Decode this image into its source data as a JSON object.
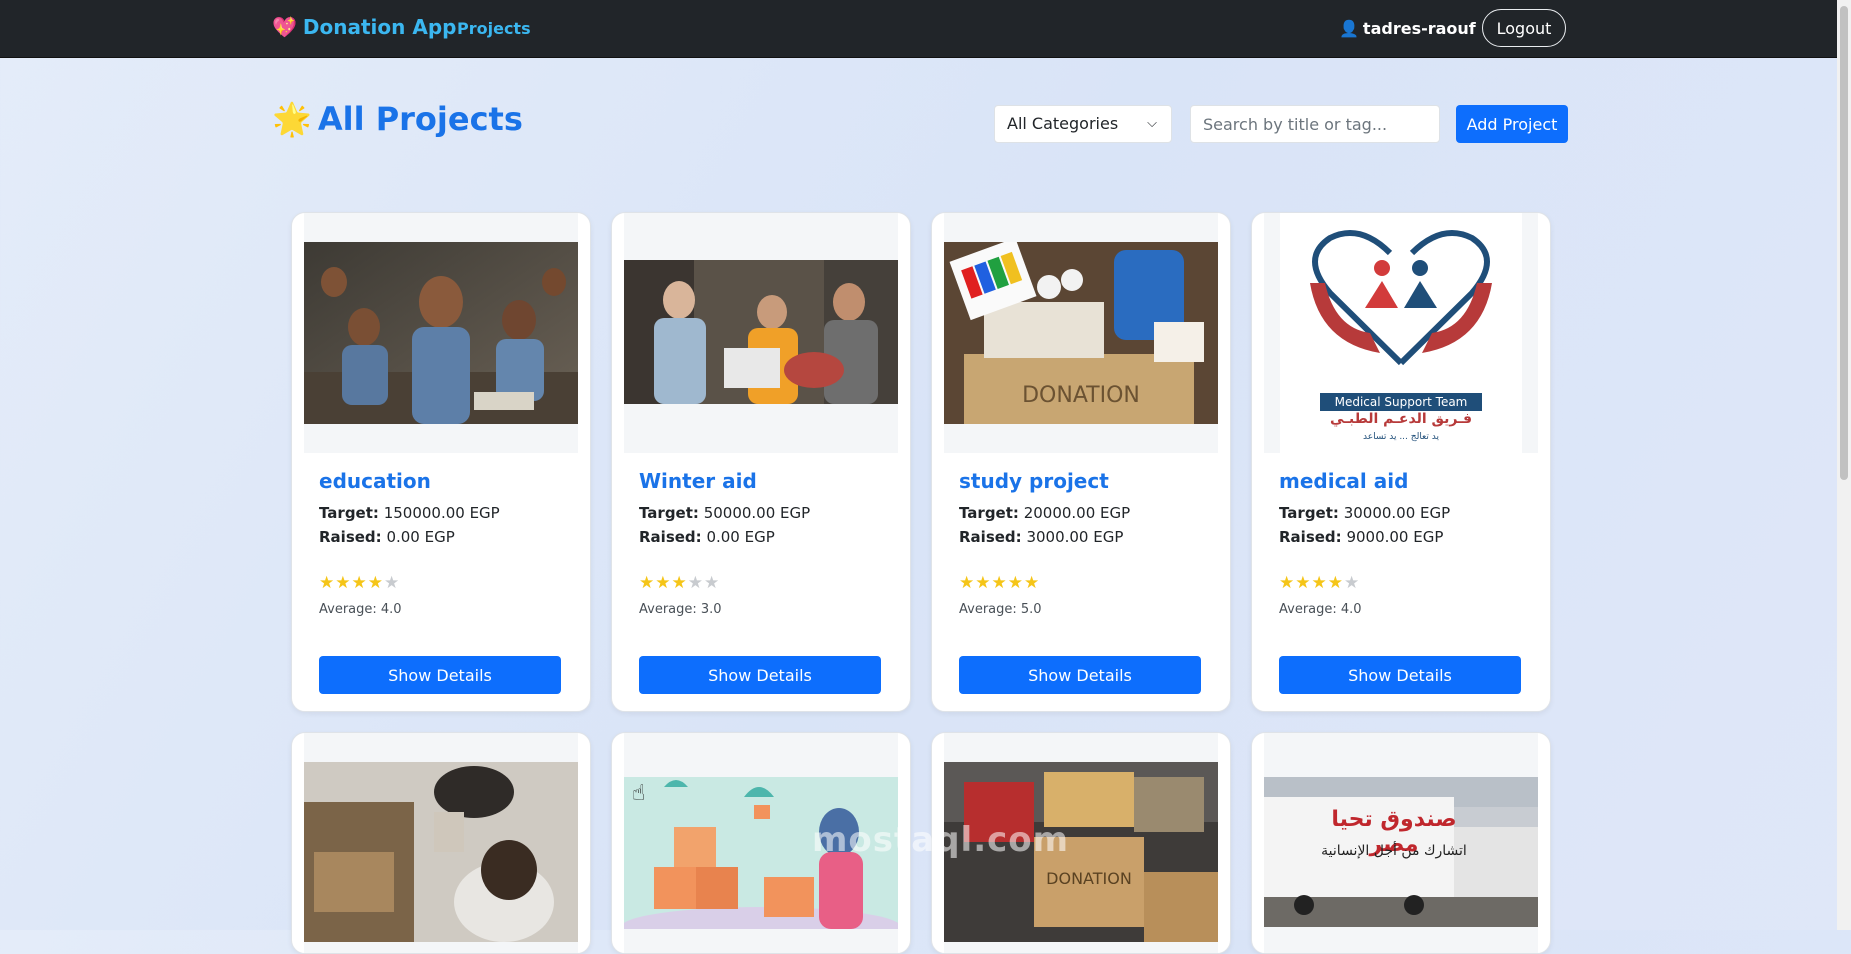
{
  "navbar": {
    "brand": "Donation App",
    "brand_icon": "heart-icon",
    "projects_link": "Projects",
    "user_icon": "user-icon",
    "username": "tadres-raouf",
    "logout_label": "Logout"
  },
  "header": {
    "title": "All Projects",
    "title_icon": "sparkle-star-icon",
    "category_selected": "All Categories",
    "search_placeholder": "Search by title or tag...",
    "add_label": "Add Project"
  },
  "labels": {
    "target": "Target:",
    "raised": "Raised:",
    "details": "Show Details"
  },
  "colors": {
    "navbar_bg": "#212529",
    "accent": "#0d6efd",
    "link": "#3bb7f0",
    "star": "#f5c518"
  },
  "projects": [
    {
      "title": "education",
      "target": "150000.00 EGP",
      "raised": "0.00 EGP",
      "rating": 4,
      "average": "Average: 4.0",
      "image": "classroom-children-photo"
    },
    {
      "title": "Winter aid",
      "target": "50000.00 EGP",
      "raised": "0.00 EGP",
      "rating": 3,
      "average": "Average: 3.0",
      "image": "aid-volunteers-photo"
    },
    {
      "title": "study project",
      "target": "20000.00 EGP",
      "raised": "3000.00 EGP",
      "rating": 5,
      "average": "Average: 5.0",
      "image": "school-supplies-donation-box-photo"
    },
    {
      "title": "medical aid",
      "target": "30000.00 EGP",
      "raised": "9000.00 EGP",
      "rating": 4,
      "average": "Average: 4.0",
      "image": "medical-support-team-logo"
    }
  ],
  "medical_logo": {
    "line1": "Medical Support Team",
    "line2": "فـريق الدعـم الطبـي",
    "line3": "يد تعالج ... يد تساعد"
  },
  "second_row": [
    {
      "image": "volunteers-boxes-photo"
    },
    {
      "image": "donation-boxes-illustration"
    },
    {
      "image": "clothes-donation-box-photo"
    },
    {
      "image": "aid-trucks-convoy-photo",
      "banner_line1": "صندوق تحيا مصر",
      "banner_line2": "اتشارك من أجل الإنسانية"
    }
  ],
  "watermark": "mostaql.com"
}
